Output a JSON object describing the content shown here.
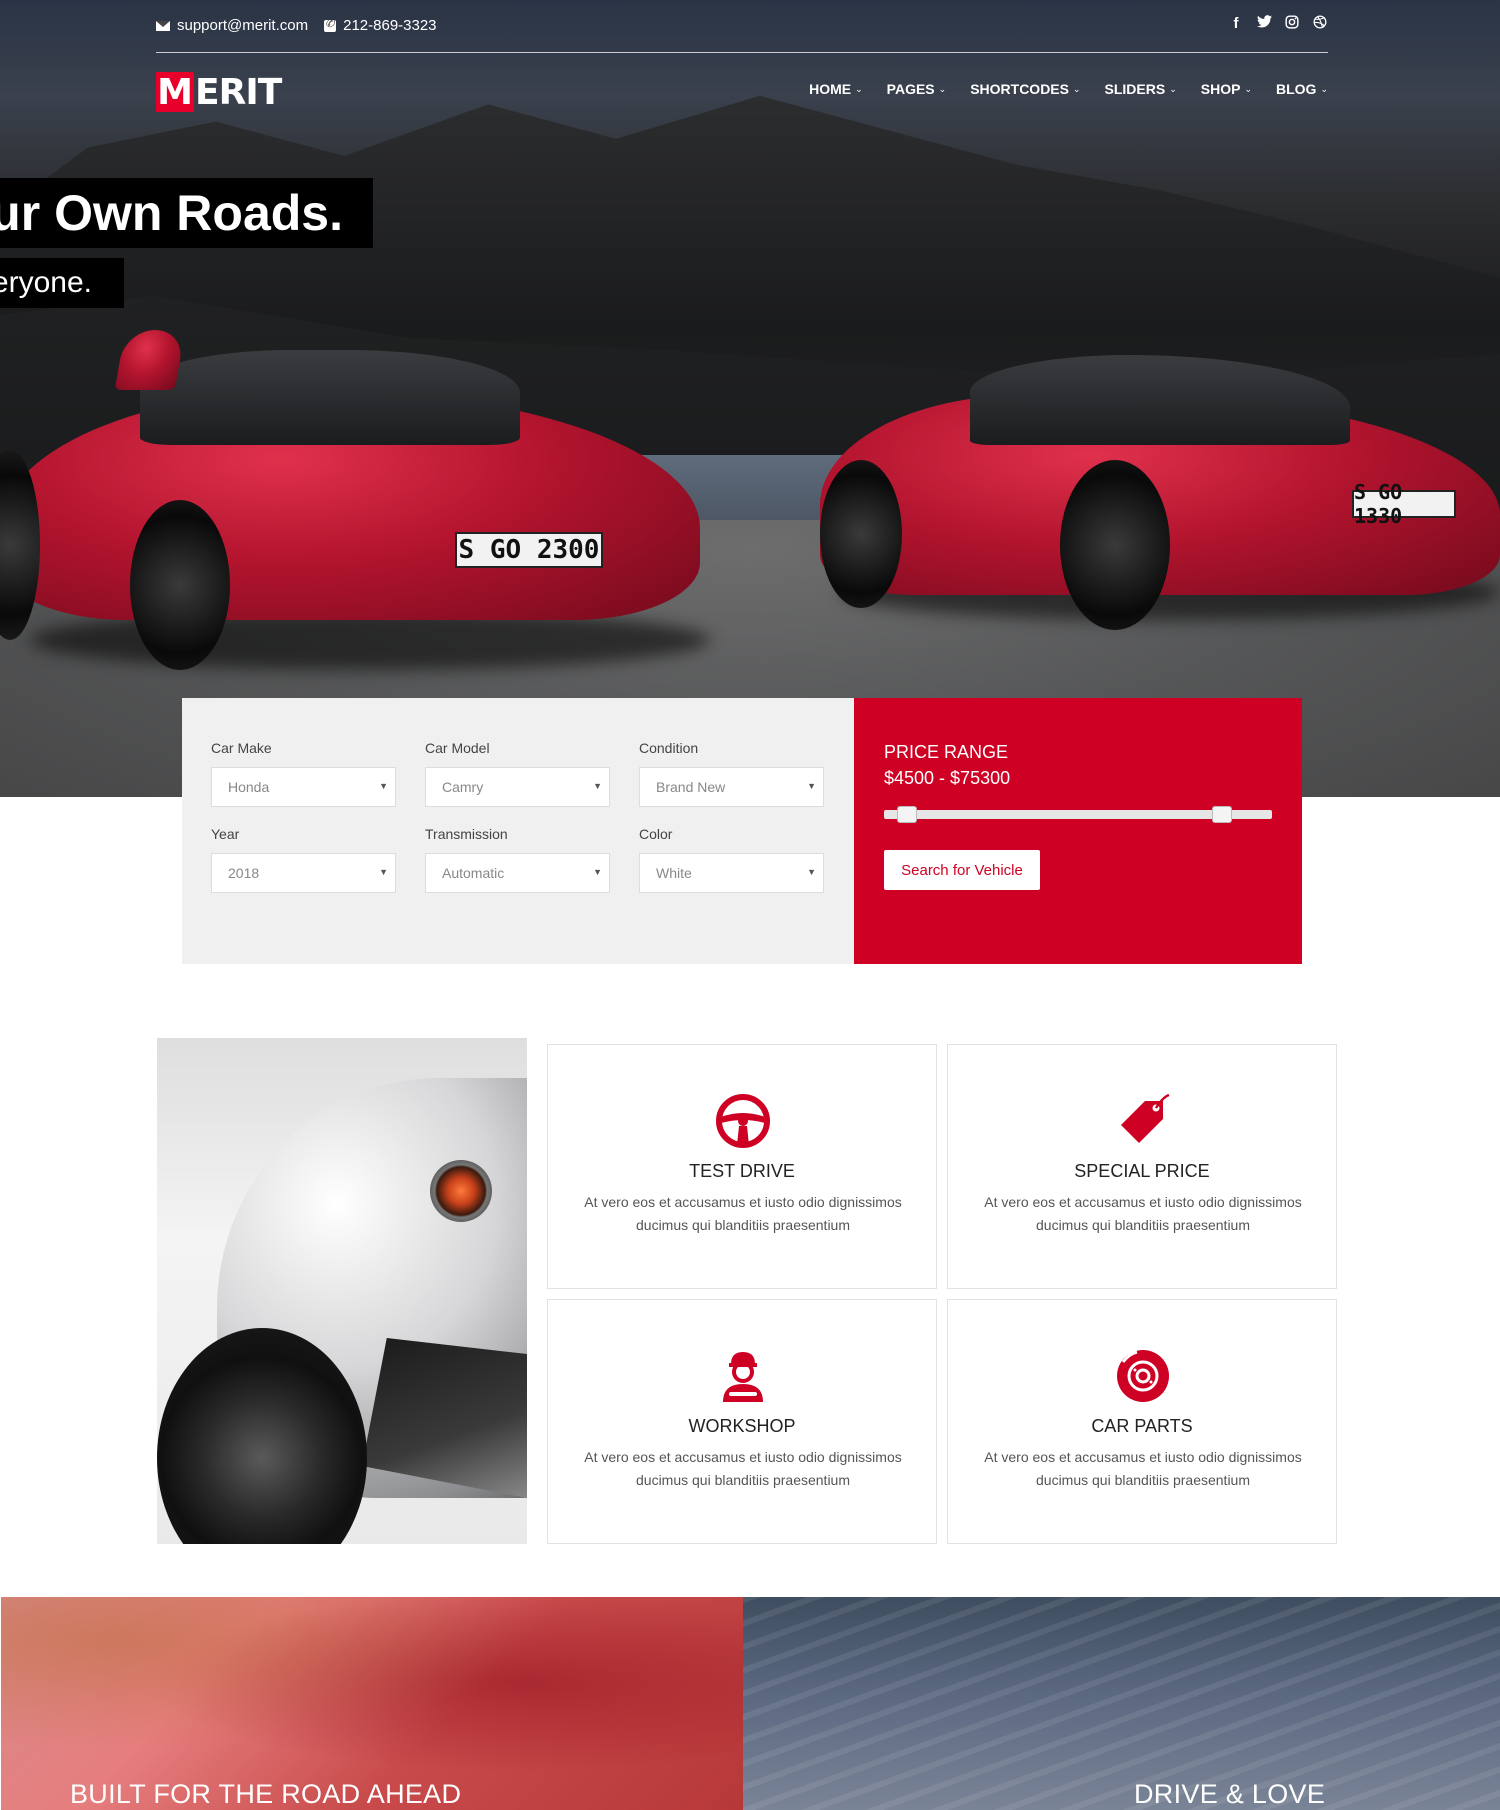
{
  "topbar": {
    "email": "support@merit.com",
    "phone": "212-869-3323",
    "social_icons": [
      "facebook-icon",
      "twitter-icon",
      "instagram-icon",
      "dribbble-icon"
    ]
  },
  "logo": {
    "initial": "M",
    "rest": "ERIT"
  },
  "nav": {
    "items": [
      {
        "label": "HOME"
      },
      {
        "label": "PAGES"
      },
      {
        "label": "SHORTCODES"
      },
      {
        "label": "SLIDERS"
      },
      {
        "label": "SHOP"
      },
      {
        "label": "BLOG"
      }
    ]
  },
  "hero": {
    "title": "our Own Roads.",
    "subtitle": "eryone.",
    "plates": [
      "S GO 2300",
      "S GO 1330"
    ]
  },
  "search": {
    "fields": [
      {
        "label": "Car Make",
        "value": "Honda"
      },
      {
        "label": "Car Model",
        "value": "Camry"
      },
      {
        "label": "Condition",
        "value": "Brand New"
      },
      {
        "label": "Year",
        "value": "2018"
      },
      {
        "label": "Transmission",
        "value": "Automatic"
      },
      {
        "label": "Color",
        "value": "White"
      }
    ],
    "price_title": "PRICE RANGE",
    "price_value": "$4500 - $75300",
    "slider_low": 0.06,
    "slider_high": 0.87,
    "button_label": "Search for Vehicle"
  },
  "features": [
    {
      "title": "TEST DRIVE",
      "desc": "At vero eos et accusamus et iusto odio dignissimos ducimus qui blanditiis praesentium",
      "icon": "steering-wheel-icon"
    },
    {
      "title": "SPECIAL PRICE",
      "desc": "At vero eos et accusamus et iusto odio dignissimos ducimus qui blanditiis praesentium",
      "icon": "price-tag-icon"
    },
    {
      "title": "WORKSHOP",
      "desc": "At vero eos et accusamus et iusto odio dignissimos ducimus qui blanditiis praesentium",
      "icon": "mechanic-icon"
    },
    {
      "title": "CAR PARTS",
      "desc": "At vero eos et accusamus et iusto odio dignissimos ducimus qui blanditiis praesentium",
      "icon": "brake-disc-icon"
    }
  ],
  "banners": {
    "left": "BUILT FOR THE ROAD AHEAD",
    "right": "DRIVE & LOVE"
  },
  "colors": {
    "accent": "#ce0023",
    "panel_gray": "#f0f0f0"
  }
}
